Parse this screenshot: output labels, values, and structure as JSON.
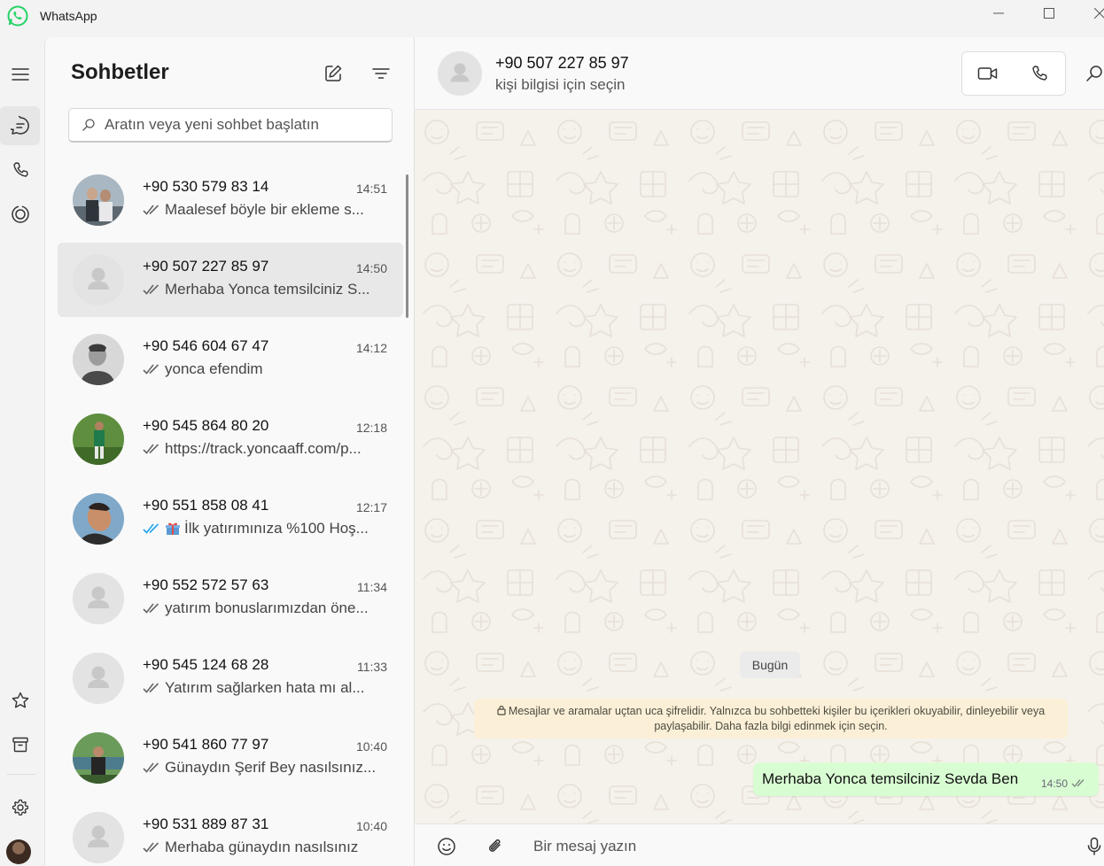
{
  "window": {
    "title": "WhatsApp",
    "brand_color": "#25D366"
  },
  "rail": {
    "items": [
      {
        "name": "menu",
        "icon": "hamburger-icon"
      },
      {
        "name": "chats",
        "icon": "chat-icon",
        "active": true
      },
      {
        "name": "calls",
        "icon": "phone-icon"
      },
      {
        "name": "status",
        "icon": "status-icon"
      },
      {
        "name": "starred",
        "icon": "star-icon"
      },
      {
        "name": "archived",
        "icon": "archive-icon"
      },
      {
        "name": "settings",
        "icon": "gear-icon"
      },
      {
        "name": "profile",
        "icon": "avatar"
      }
    ]
  },
  "list": {
    "title": "Sohbetler",
    "search_placeholder": "Aratın veya yeni sohbet başlatın",
    "chats": [
      {
        "name": "+90 530 579 83 14",
        "time": "14:51",
        "preview": "Maalesef böyle bir ekleme s...",
        "ticks": "read-gray",
        "avatar": "photo"
      },
      {
        "name": "+90 507 227 85 97",
        "time": "14:50",
        "preview": "Merhaba Yonca temsilciniz S...",
        "ticks": "read-gray",
        "avatar": "default",
        "selected": true
      },
      {
        "name": "+90 546 604 67 47",
        "time": "14:12",
        "preview": "yonca efendim",
        "ticks": "read-gray",
        "avatar": "photo"
      },
      {
        "name": "+90 545 864 80 20",
        "time": "12:18",
        "preview": "https://track.yoncaaff.com/p...",
        "ticks": "read-gray",
        "avatar": "photo"
      },
      {
        "name": "+90 551 858 08 41",
        "time": "12:17",
        "preview": "İlk yatırımınıza %100 Hoş...",
        "ticks": "read-blue",
        "avatar": "photo",
        "emoji": "gift-icon"
      },
      {
        "name": "+90 552 572 57 63",
        "time": "11:34",
        "preview": "yatırım bonuslarımızdan öne...",
        "ticks": "read-gray",
        "avatar": "default"
      },
      {
        "name": "+90 545 124 68 28",
        "time": "11:33",
        "preview": "Yatırım sağlarken hata mı al...",
        "ticks": "read-gray",
        "avatar": "default"
      },
      {
        "name": "+90 541 860 77 97",
        "time": "10:40",
        "preview": "Günaydın Şerif Bey nasılsınız...",
        "ticks": "read-gray",
        "avatar": "photo"
      },
      {
        "name": "+90 531 889 87 31",
        "time": "10:40",
        "preview": "Merhaba günaydın nasılsınız",
        "ticks": "read-gray",
        "avatar": "default"
      }
    ]
  },
  "conversation": {
    "name": "+90 507 227 85 97",
    "subtitle": "kişi bilgisi için seçin",
    "date_label": "Bugün",
    "encryption_notice": "Mesajlar ve aramalar uçtan uca şifrelidir. Yalnızca bu sohbetteki kişiler bu içerikleri okuyabilir, dinleyebilir veya paylaşabilir. Daha fazla bilgi edinmek için seçin.",
    "messages": [
      {
        "direction": "out",
        "text": "Merhaba Yonca temsilciniz Sevda Ben",
        "time": "14:50",
        "ticks": "read-gray"
      }
    ],
    "composer_placeholder": "Bir mesaj yazın",
    "colors": {
      "outgoing_bubble": "#D9FDD3",
      "notice_bg": "#FBF0D7",
      "wallpaper": "#F5F1EB",
      "read_blue": "#1FA6F0"
    }
  }
}
